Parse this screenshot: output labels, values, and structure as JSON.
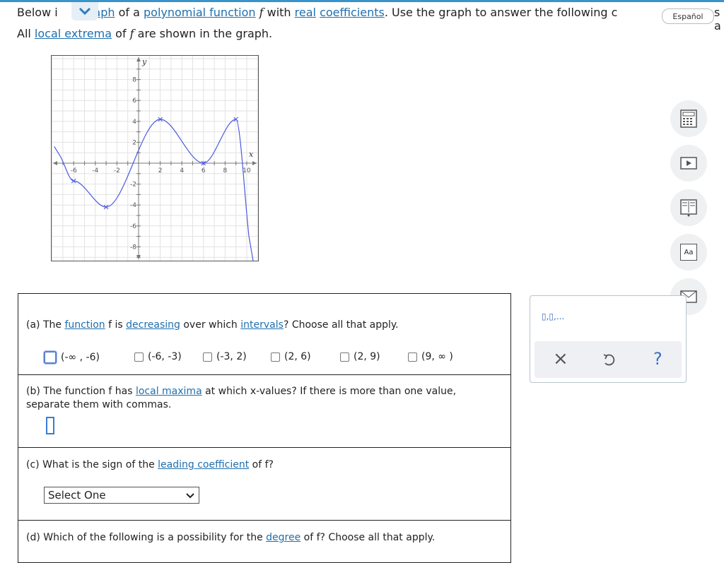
{
  "intro": {
    "line1_pre": "Below i",
    "line1_graph": "graph",
    "line1_of_a": " of a ",
    "line1_poly": "polynomial function",
    "line1_f": "f",
    "line1_with": " with ",
    "line1_real": "real",
    "line1_coeff": "coefficients",
    "line1_rest": ". Use the graph to answer the following c",
    "line1_tail": "s a",
    "line2_all": "All ",
    "line2_local": "local extrema",
    "line2_of": " of ",
    "line2_f": "f",
    "line2_rest": " are shown in the graph."
  },
  "language_button": "Español",
  "graph": {
    "x_label": "x",
    "y_label": "y",
    "x_ticks": [
      "-6",
      "-4",
      "-2",
      "2",
      "4",
      "6",
      "8",
      "10"
    ],
    "y_ticks": [
      "8",
      "6",
      "4",
      "2",
      "-2",
      "-4",
      "-6",
      "-8"
    ],
    "curve_color": "#4a5ae0",
    "extrema_points": [
      {
        "x": -6,
        "y": -1.7
      },
      {
        "x": -3,
        "y": -4.2
      },
      {
        "x": 2,
        "y": 4.2
      },
      {
        "x": 6,
        "y": 0
      },
      {
        "x": 9,
        "y": 4.2
      }
    ]
  },
  "tools": [
    "calculator-icon",
    "play-video-icon",
    "textbook-icon",
    "glossary-icon",
    "mail-icon"
  ],
  "tool_labels": {
    "glossary": "Aa"
  },
  "part_a": {
    "question_pre": "(a) The ",
    "function_link": "function",
    "q_mid": " f is ",
    "decreasing_link": "decreasing",
    "q_mid2": " over which ",
    "intervals_link": "intervals",
    "q_end": "? Choose all that apply.",
    "options": [
      "(-∞ , -6)",
      "(-6, -3)",
      "(-3, 2)",
      "(2, 6)",
      "(2, 9)",
      "(9, ∞ )"
    ]
  },
  "part_b": {
    "q_pre": "(b) The function f has ",
    "maxima_link": "local maxima",
    "q_end": " at which x-values? If there is more than one value,",
    "q_line2": "separate them with commas."
  },
  "part_c": {
    "q_pre": "(c) What is the sign of the ",
    "leading_link": "leading coefficient",
    "q_end": " of f?",
    "select_value": "Select One"
  },
  "part_d": {
    "q_pre": "(d) Which of the following is a possibility for the ",
    "degree_link": "degree",
    "q_end": " of f? Choose all that apply."
  },
  "answer_panel": {
    "template_label": "▯,▯,...",
    "clear_label": "×",
    "help_label": "?"
  }
}
